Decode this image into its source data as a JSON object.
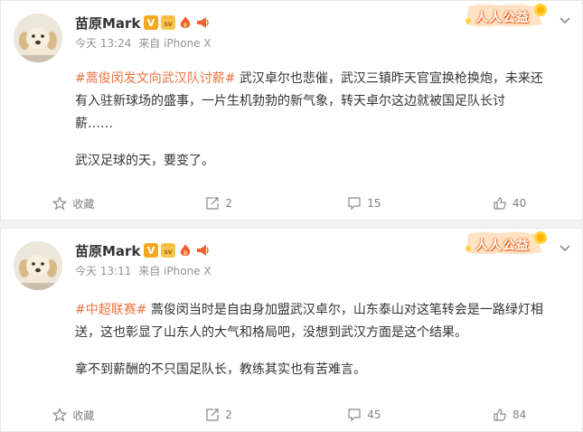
{
  "posts": [
    {
      "author": "苗原Mark",
      "time": "今天 13:24",
      "source": "来自 iPhone X",
      "charity_label": "人人公益",
      "topic": "#蒿俊闵发文向武汉队讨薪#",
      "text_line1": "武汉卓尔也悲催，武汉三镇昨天官宣换枪换炮，未来还",
      "text_line2": "有入驻新球场的盛事，一片生机勃勃的新气象，转天卓尔这边就被国足队长讨",
      "text_line3": "薪……",
      "text_para2": "武汉足球的天，要变了。",
      "actions": {
        "favorite": "收藏",
        "repost": "2",
        "comment": "15",
        "like": "40"
      }
    },
    {
      "author": "苗原Mark",
      "time": "今天 13:11",
      "source": "来自 iPhone X",
      "charity_label": "人人公益",
      "topic": "#中超联赛#",
      "text_line1": "蒿俊闵当时是自由身加盟武汉卓尔，山东泰山对这笔转会是一路绿灯相",
      "text_line2": "送，这也彰显了山东人的大气和格局吧，没想到武汉方面是这个结果。",
      "text_para2": "拿不到薪酬的不只国足队长，教练其实也有苦难言。",
      "actions": {
        "favorite": "收藏",
        "repost": "2",
        "comment": "45",
        "like": "84"
      }
    }
  ],
  "colors": {
    "topic": "#eb7340",
    "meta": "#939393",
    "action": "#808080",
    "badge_v": "#f6a723"
  },
  "icons": [
    "avatar-dog-icon",
    "verified-v-icon",
    "svip-icon",
    "fire-icon",
    "horn-icon",
    "chevron-down-icon",
    "star-icon",
    "repost-icon",
    "comment-icon",
    "like-icon"
  ]
}
